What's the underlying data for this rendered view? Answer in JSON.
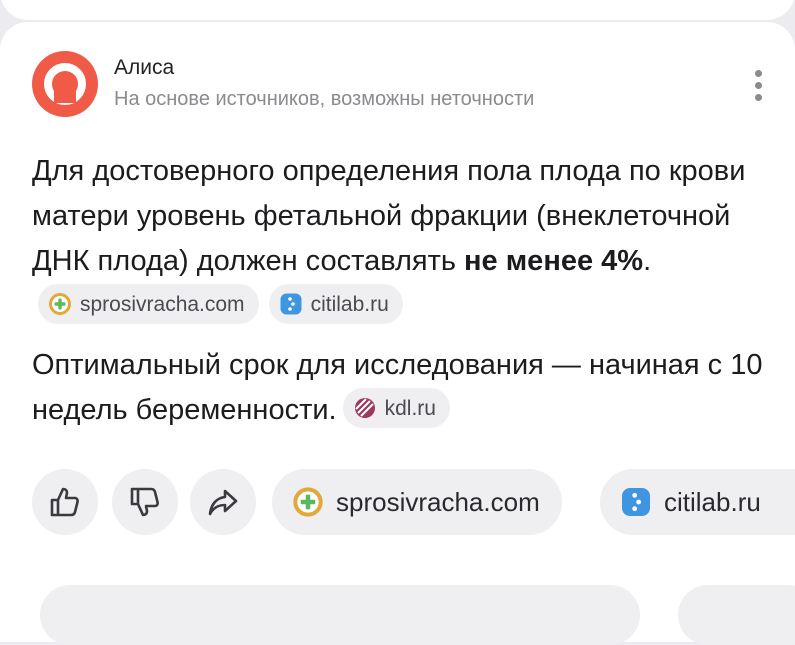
{
  "assistant": {
    "name": "Алиса",
    "disclaimer": "На основе источников, возможны неточности"
  },
  "answer": {
    "p1_text": "Для достоверного определения пола плода по крови матери уровень фетальной фракции (внеклеточной ДНК плода) должен составлять ",
    "p1_bold": "не менее 4%",
    "p1_end": ".",
    "p1_sources": [
      "sprosivracha.com",
      "citilab.ru"
    ],
    "p2_text": "Оптимальный срок для исследования — начиная с 10 недель беременности.",
    "p2_sources": [
      "kdl.ru"
    ]
  },
  "actions": {
    "like_icon": "thumbs-up-icon",
    "dislike_icon": "thumbs-down-icon",
    "share_icon": "share-icon"
  },
  "source_chips": [
    "sprosivracha.com",
    "citilab.ru"
  ],
  "colors": {
    "avatar": "#f05b47",
    "chip_bg": "#efeff2",
    "sprosivracha_ring": "#e2a83c",
    "sprosivracha_cross": "#5cb85c",
    "citilab": "#3f95e0",
    "kdl": "#9b3a5c"
  }
}
